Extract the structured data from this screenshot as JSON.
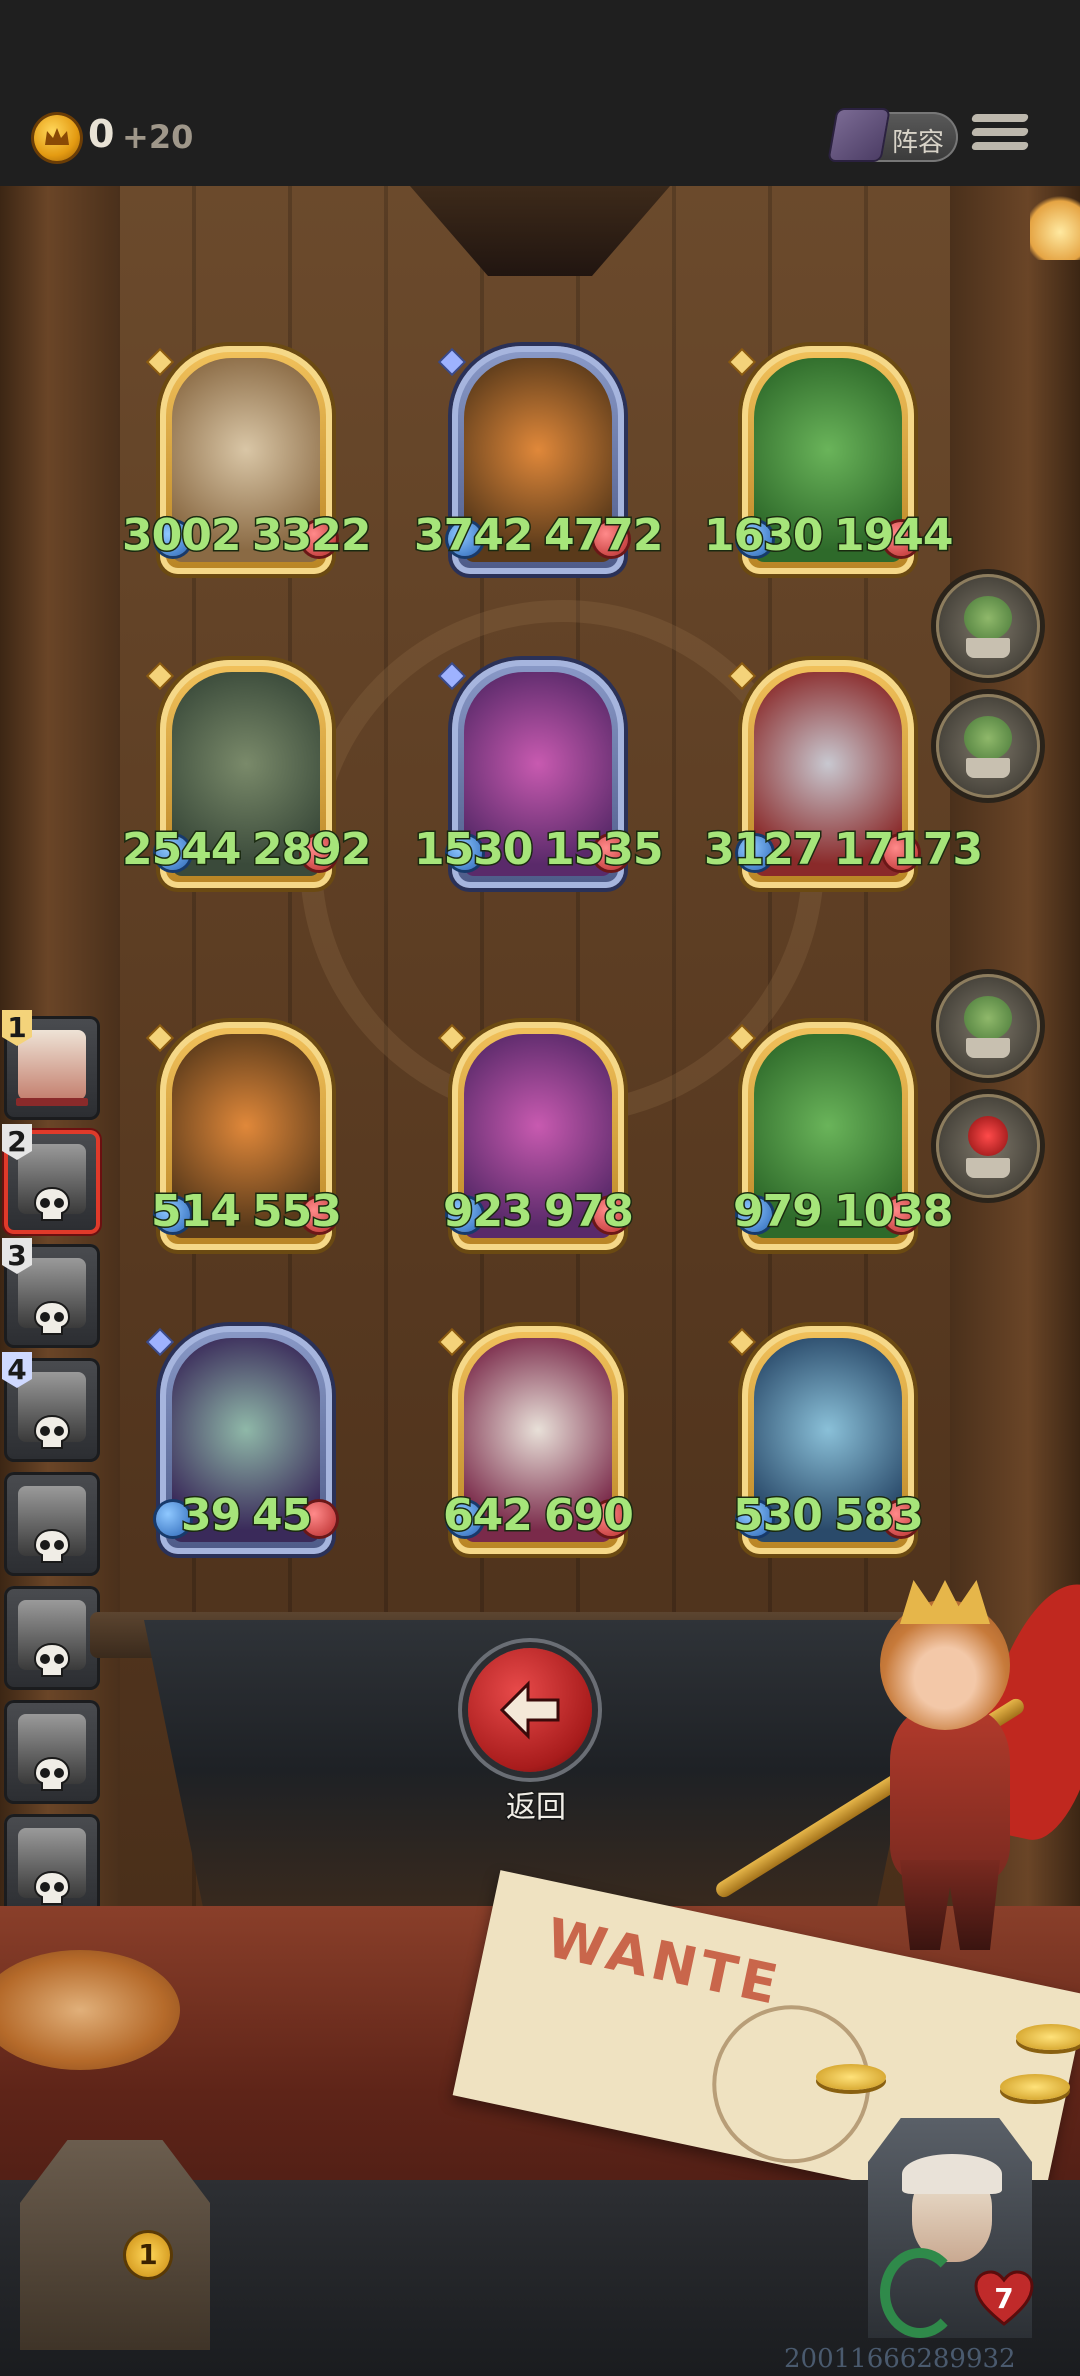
{
  "header": {
    "coins": "0",
    "coin_bonus": "+20",
    "lineup_label": "阵容"
  },
  "cards": [
    {
      "id": "r1c1",
      "frame": "gold",
      "attack": "3002",
      "health": "3322",
      "portrait": "treant-icon"
    },
    {
      "id": "r1c2",
      "frame": "blue",
      "attack": "3742",
      "health": "4772",
      "portrait": "pumpkin-icon"
    },
    {
      "id": "r1c3",
      "frame": "gold",
      "attack": "1630",
      "health": "1944",
      "portrait": "cactus-icon"
    },
    {
      "id": "r2c1",
      "frame": "gold",
      "attack": "2544",
      "health": "2892",
      "portrait": "rock-golem-icon"
    },
    {
      "id": "r2c2",
      "frame": "blue",
      "attack": "1530",
      "health": "1535",
      "portrait": "pink-hair-girl-icon"
    },
    {
      "id": "r2c3",
      "frame": "gold",
      "attack": "3127",
      "health": "17173",
      "portrait": "knight-icon"
    },
    {
      "id": "r3c1",
      "frame": "gold",
      "attack": "514",
      "health": "553",
      "portrait": "pumpkin-icon"
    },
    {
      "id": "r3c2",
      "frame": "gold",
      "attack": "923",
      "health": "978",
      "portrait": "pink-hair-girl-icon"
    },
    {
      "id": "r3c3",
      "frame": "gold",
      "attack": "979",
      "health": "1038",
      "portrait": "cactus-icon"
    },
    {
      "id": "r4c1",
      "frame": "blue",
      "attack": "39",
      "health": "45",
      "portrait": "demon-girl-icon"
    },
    {
      "id": "r4c2",
      "frame": "gold",
      "attack": "642",
      "health": "690",
      "portrait": "clown-icon"
    },
    {
      "id": "r4c3",
      "frame": "gold",
      "attack": "530",
      "health": "583",
      "portrait": "dragon-icon"
    }
  ],
  "side_slots": [
    {
      "num": "1",
      "active": true
    },
    {
      "num": "2",
      "selected": true
    },
    {
      "num": "3"
    },
    {
      "num": "4"
    },
    {
      "num": ""
    },
    {
      "num": ""
    },
    {
      "num": ""
    },
    {
      "num": ""
    }
  ],
  "back_label": "返回",
  "poster_text": "WANTE",
  "chest_count": "1",
  "hero_lives": "7",
  "watermark": "20011666289932",
  "colors": {
    "stat_green": "#a6e57a",
    "gold_frame": "#f2c25c",
    "blue_frame": "#8a9ac8",
    "back_button_red": "#c22626"
  }
}
